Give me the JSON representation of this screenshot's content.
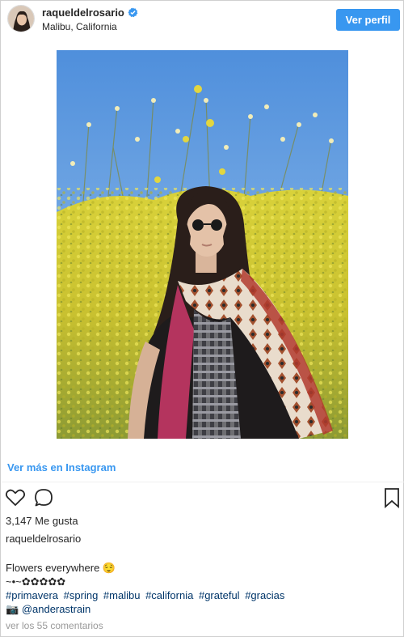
{
  "header": {
    "username": "raqueldelrosario",
    "location": "Malibu, California",
    "view_profile_label": "Ver perfil"
  },
  "photo": {
    "alt": "Mujer con gafas de sol y pañuelo en un campo de flores amarillas",
    "colors": {
      "sky": "#5d9be0",
      "flowers": "#d8cf2e",
      "foliage": "#6f8a3a"
    }
  },
  "links": {
    "view_more": "Ver más en Instagram"
  },
  "post": {
    "likes": "3,147 Me gusta",
    "author": "raqueldelrosario",
    "caption_line1": "Flowers everywhere 😌",
    "caption_line2": "~•~✿✿✿✿✿",
    "hashtags": [
      "#primavera",
      "#spring",
      "#malibu",
      "#california",
      "#grateful",
      "#gracias"
    ],
    "credit_prefix": "📷",
    "credit_mention": "@anderastrain",
    "comments": "ver los 55 comentarios"
  },
  "colors": {
    "accent": "#3897f0",
    "text": "#262626",
    "muted": "#999999",
    "link": "#003569"
  },
  "icons": [
    "verified-badge-icon",
    "heart-icon",
    "comment-icon",
    "bookmark-icon"
  ]
}
